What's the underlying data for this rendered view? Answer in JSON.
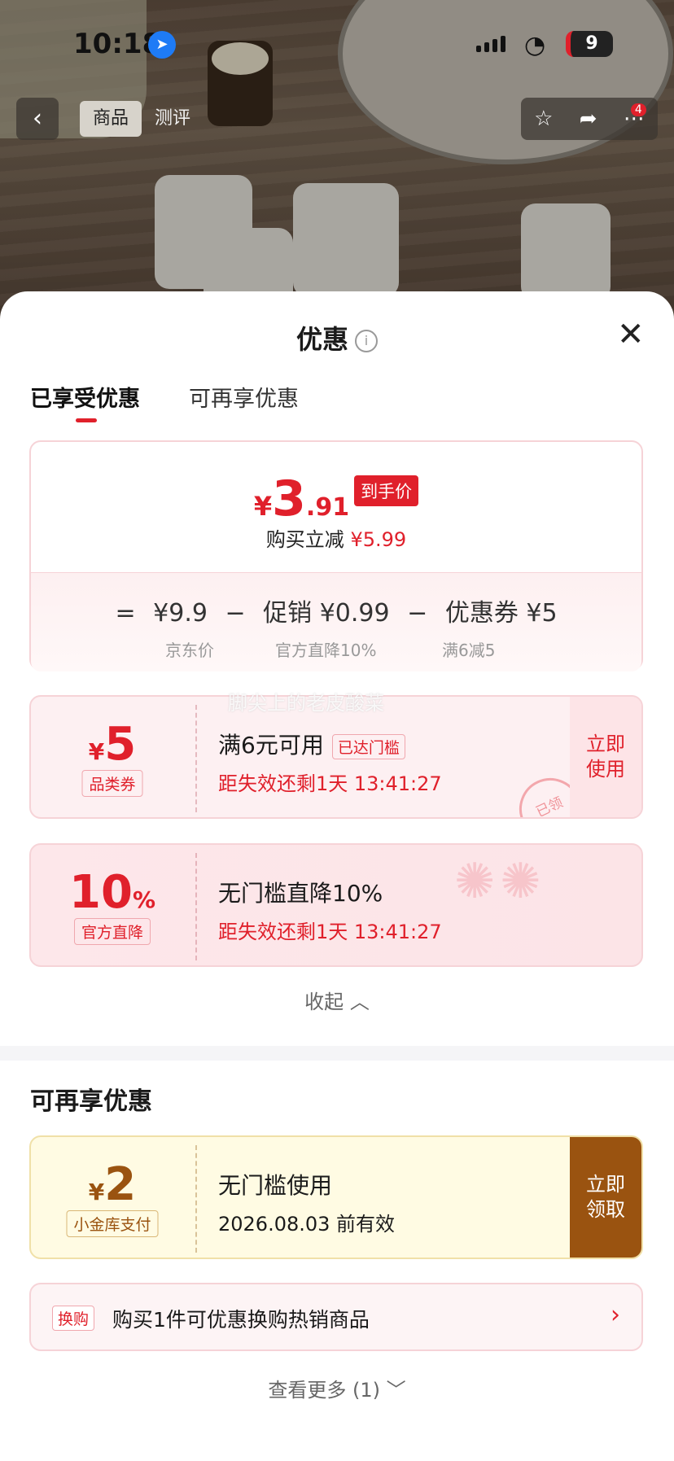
{
  "status": {
    "time": "10:18",
    "battery": "9"
  },
  "nav": {
    "tabs": [
      "商品",
      "测评"
    ],
    "badge": "4"
  },
  "sheet": {
    "title": "优惠",
    "tabs": [
      "已享受优惠",
      "可再享优惠"
    ]
  },
  "price_card": {
    "currency": "¥",
    "integer": "3",
    "decimal": ".91",
    "tag": "到手价",
    "reduce_label": "购买立减",
    "reduce_value": "¥5.99",
    "formula": {
      "eq": "=",
      "jd_price": "¥9.9",
      "minus1": "−",
      "promo": "促销 ¥0.99",
      "minus2": "−",
      "coupon": "优惠券 ¥5",
      "jd_label": "京东价",
      "promo_label": "官方直降10%",
      "coupon_label": "满6减5"
    }
  },
  "watermark": "脚尖上的老皮酸菜",
  "coupons": [
    {
      "yen": "¥",
      "amount": "5",
      "kind": "品类券",
      "title": "满6元可用",
      "badge": "已达门槛",
      "expiry": "距失效还剩1天 13:41:27",
      "button": [
        "立即",
        "使用"
      ],
      "stamp": "已领"
    },
    {
      "amount": "10",
      "unit": "%",
      "kind": "官方直降",
      "title": "无门槛直降10%",
      "expiry": "距失效还剩1天 13:41:27"
    }
  ],
  "collapse_label": "收起",
  "more_section": {
    "title": "可再享优惠",
    "coupon": {
      "yen": "¥",
      "amount": "2",
      "kind": "小金库支付",
      "title": "无门槛使用",
      "expiry": "2026.08.03 前有效",
      "button": [
        "立即",
        "领取"
      ]
    },
    "exchange": {
      "tag": "换购",
      "text": "购买1件可优惠换购热销商品"
    },
    "view_more": "查看更多 (1)"
  },
  "colors": {
    "accent": "#e0202b",
    "gold": "#9a5310"
  }
}
